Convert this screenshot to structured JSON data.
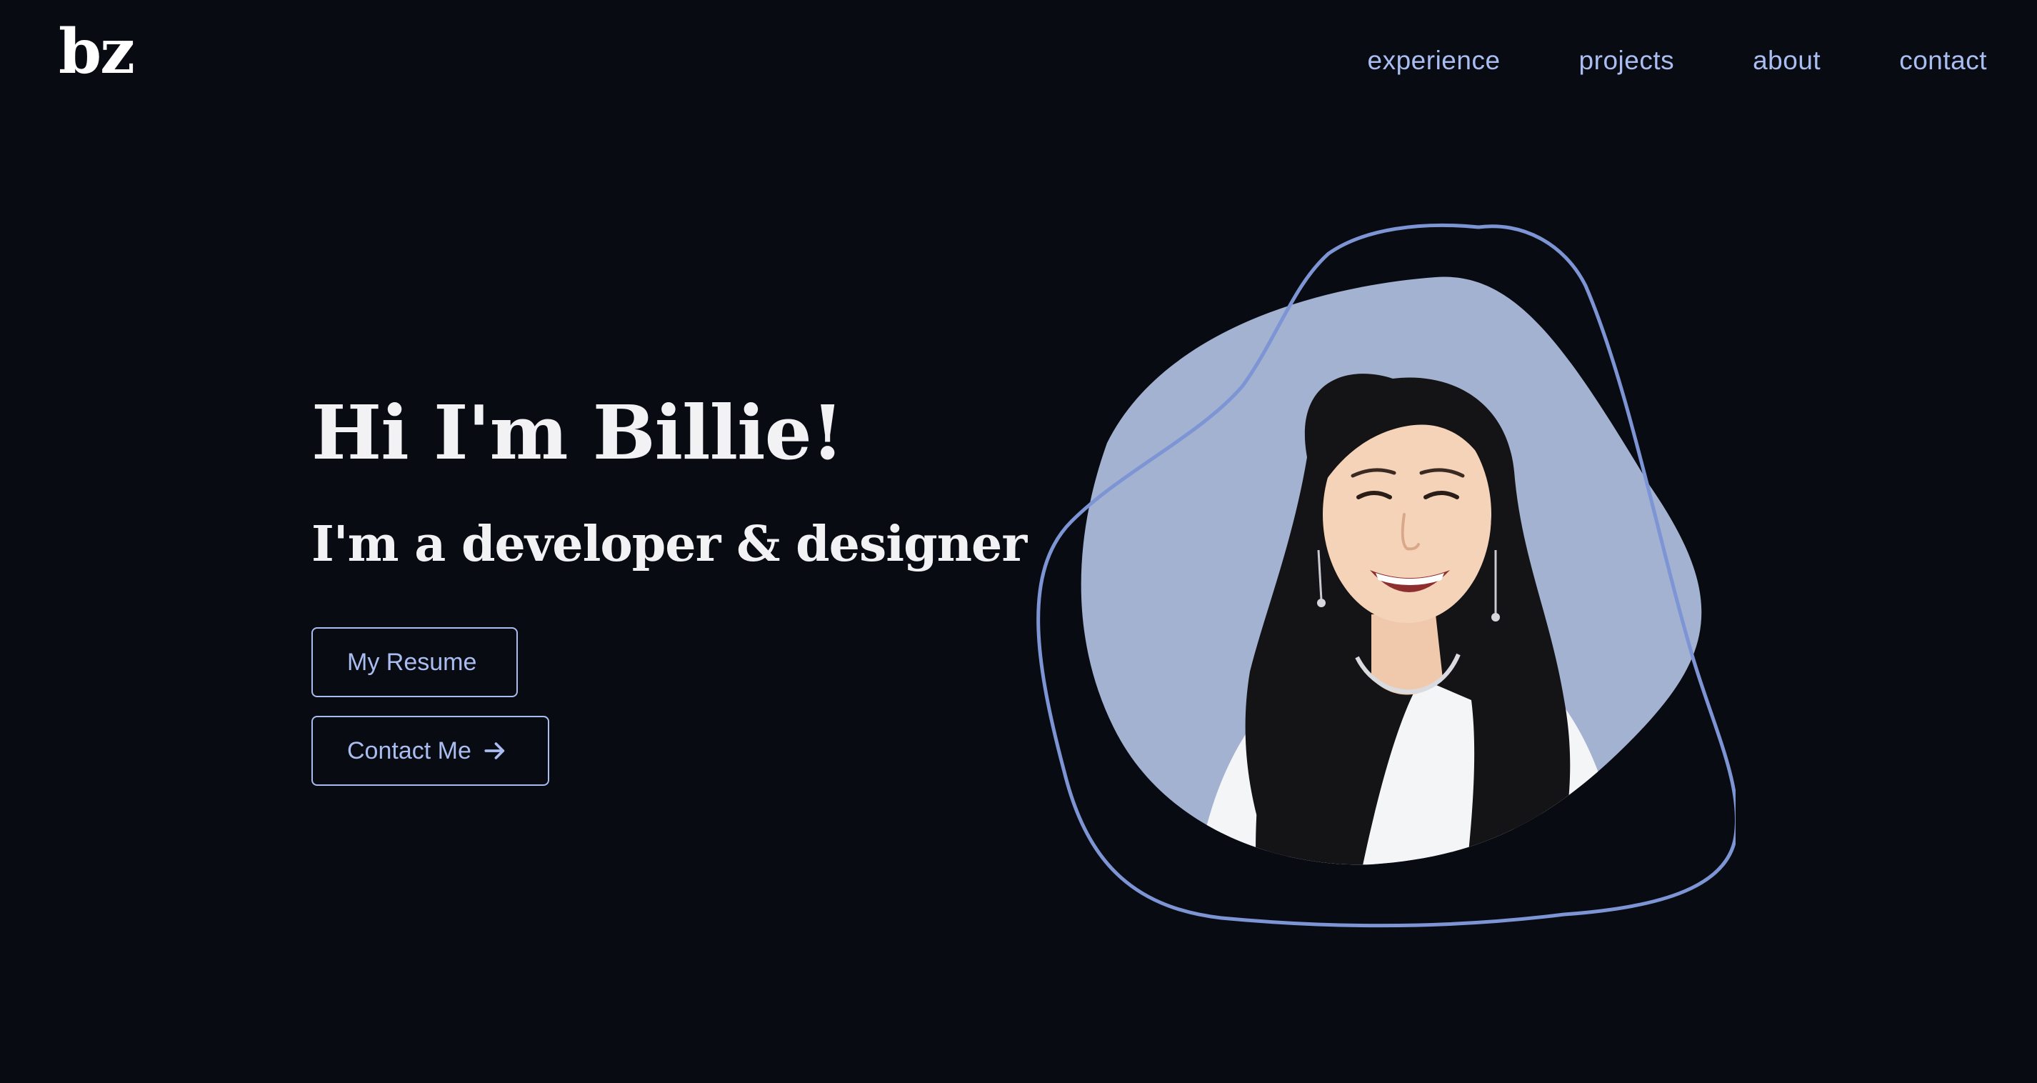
{
  "header": {
    "logo": "bz",
    "nav": [
      "experience",
      "projects",
      "about",
      "contact"
    ]
  },
  "hero": {
    "title": "Hi I'm Billie!",
    "subtitle": "I'm a developer & designer",
    "resume_button": "My Resume",
    "contact_button": "Contact Me",
    "contact_icon": "arrow-right-icon"
  },
  "colors": {
    "background": "#090b13",
    "accent": "#a9bdf0",
    "blob_fill": "#a2b2d0",
    "outline": "#7d95d4",
    "text": "#f2f2f5"
  }
}
